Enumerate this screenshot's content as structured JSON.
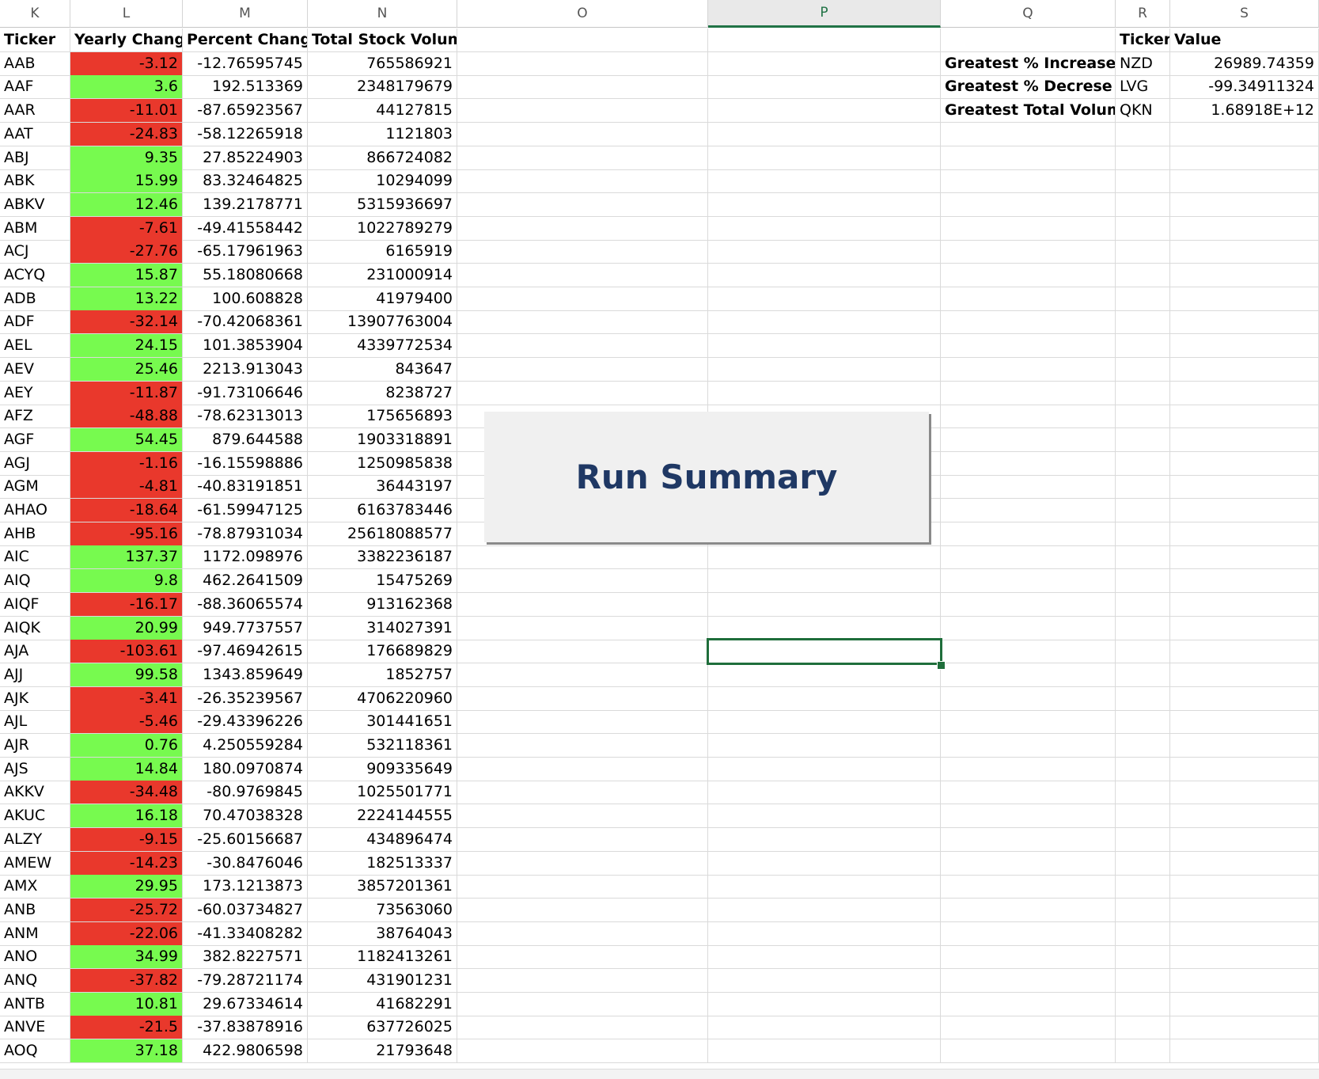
{
  "columns": [
    {
      "letter": "K",
      "selected": false
    },
    {
      "letter": "L",
      "selected": false
    },
    {
      "letter": "M",
      "selected": false
    },
    {
      "letter": "N",
      "selected": false
    },
    {
      "letter": "O",
      "selected": false
    },
    {
      "letter": "P",
      "selected": true
    },
    {
      "letter": "Q",
      "selected": false
    },
    {
      "letter": "R",
      "selected": false
    },
    {
      "letter": "S",
      "selected": false
    }
  ],
  "table_headers": {
    "ticker": "Ticker",
    "yearly_change": "Yearly Change",
    "percent_change": "Percent Change",
    "total_volume": "Total Stock Volume"
  },
  "rows": [
    {
      "ticker": "AAB",
      "yearly": "-3.12",
      "positive": false,
      "pct": "-12.76595745",
      "vol": "765586921"
    },
    {
      "ticker": "AAF",
      "yearly": "3.6",
      "positive": true,
      "pct": "192.513369",
      "vol": "2348179679"
    },
    {
      "ticker": "AAR",
      "yearly": "-11.01",
      "positive": false,
      "pct": "-87.65923567",
      "vol": "44127815"
    },
    {
      "ticker": "AAT",
      "yearly": "-24.83",
      "positive": false,
      "pct": "-58.12265918",
      "vol": "1121803"
    },
    {
      "ticker": "ABJ",
      "yearly": "9.35",
      "positive": true,
      "pct": "27.85224903",
      "vol": "866724082"
    },
    {
      "ticker": "ABK",
      "yearly": "15.99",
      "positive": true,
      "pct": "83.32464825",
      "vol": "10294099"
    },
    {
      "ticker": "ABKV",
      "yearly": "12.46",
      "positive": true,
      "pct": "139.2178771",
      "vol": "5315936697"
    },
    {
      "ticker": "ABM",
      "yearly": "-7.61",
      "positive": false,
      "pct": "-49.41558442",
      "vol": "1022789279"
    },
    {
      "ticker": "ACJ",
      "yearly": "-27.76",
      "positive": false,
      "pct": "-65.17961963",
      "vol": "6165919"
    },
    {
      "ticker": "ACYQ",
      "yearly": "15.87",
      "positive": true,
      "pct": "55.18080668",
      "vol": "231000914"
    },
    {
      "ticker": "ADB",
      "yearly": "13.22",
      "positive": true,
      "pct": "100.608828",
      "vol": "41979400"
    },
    {
      "ticker": "ADF",
      "yearly": "-32.14",
      "positive": false,
      "pct": "-70.42068361",
      "vol": "13907763004"
    },
    {
      "ticker": "AEL",
      "yearly": "24.15",
      "positive": true,
      "pct": "101.3853904",
      "vol": "4339772534"
    },
    {
      "ticker": "AEV",
      "yearly": "25.46",
      "positive": true,
      "pct": "2213.913043",
      "vol": "843647"
    },
    {
      "ticker": "AEY",
      "yearly": "-11.87",
      "positive": false,
      "pct": "-91.73106646",
      "vol": "8238727"
    },
    {
      "ticker": "AFZ",
      "yearly": "-48.88",
      "positive": false,
      "pct": "-78.62313013",
      "vol": "175656893"
    },
    {
      "ticker": "AGF",
      "yearly": "54.45",
      "positive": true,
      "pct": "879.644588",
      "vol": "1903318891"
    },
    {
      "ticker": "AGJ",
      "yearly": "-1.16",
      "positive": false,
      "pct": "-16.15598886",
      "vol": "1250985838"
    },
    {
      "ticker": "AGM",
      "yearly": "-4.81",
      "positive": false,
      "pct": "-40.83191851",
      "vol": "36443197"
    },
    {
      "ticker": "AHAO",
      "yearly": "-18.64",
      "positive": false,
      "pct": "-61.59947125",
      "vol": "6163783446"
    },
    {
      "ticker": "AHB",
      "yearly": "-95.16",
      "positive": false,
      "pct": "-78.87931034",
      "vol": "25618088577"
    },
    {
      "ticker": "AIC",
      "yearly": "137.37",
      "positive": true,
      "pct": "1172.098976",
      "vol": "3382236187"
    },
    {
      "ticker": "AIQ",
      "yearly": "9.8",
      "positive": true,
      "pct": "462.2641509",
      "vol": "15475269"
    },
    {
      "ticker": "AIQF",
      "yearly": "-16.17",
      "positive": false,
      "pct": "-88.36065574",
      "vol": "913162368"
    },
    {
      "ticker": "AIQK",
      "yearly": "20.99",
      "positive": true,
      "pct": "949.7737557",
      "vol": "314027391"
    },
    {
      "ticker": "AJA",
      "yearly": "-103.61",
      "positive": false,
      "pct": "-97.46942615",
      "vol": "176689829"
    },
    {
      "ticker": "AJJ",
      "yearly": "99.58",
      "positive": true,
      "pct": "1343.859649",
      "vol": "1852757"
    },
    {
      "ticker": "AJK",
      "yearly": "-3.41",
      "positive": false,
      "pct": "-26.35239567",
      "vol": "4706220960"
    },
    {
      "ticker": "AJL",
      "yearly": "-5.46",
      "positive": false,
      "pct": "-29.43396226",
      "vol": "301441651"
    },
    {
      "ticker": "AJR",
      "yearly": "0.76",
      "positive": true,
      "pct": "4.250559284",
      "vol": "532118361"
    },
    {
      "ticker": "AJS",
      "yearly": "14.84",
      "positive": true,
      "pct": "180.0970874",
      "vol": "909335649"
    },
    {
      "ticker": "AKKV",
      "yearly": "-34.48",
      "positive": false,
      "pct": "-80.9769845",
      "vol": "1025501771"
    },
    {
      "ticker": "AKUC",
      "yearly": "16.18",
      "positive": true,
      "pct": "70.47038328",
      "vol": "2224144555"
    },
    {
      "ticker": "ALZY",
      "yearly": "-9.15",
      "positive": false,
      "pct": "-25.60156687",
      "vol": "434896474"
    },
    {
      "ticker": "AMEW",
      "yearly": "-14.23",
      "positive": false,
      "pct": "-30.8476046",
      "vol": "182513337"
    },
    {
      "ticker": "AMX",
      "yearly": "29.95",
      "positive": true,
      "pct": "173.1213873",
      "vol": "3857201361"
    },
    {
      "ticker": "ANB",
      "yearly": "-25.72",
      "positive": false,
      "pct": "-60.03734827",
      "vol": "73563060"
    },
    {
      "ticker": "ANM",
      "yearly": "-22.06",
      "positive": false,
      "pct": "-41.33408282",
      "vol": "38764043"
    },
    {
      "ticker": "ANO",
      "yearly": "34.99",
      "positive": true,
      "pct": "382.8227571",
      "vol": "1182413261"
    },
    {
      "ticker": "ANQ",
      "yearly": "-37.82",
      "positive": false,
      "pct": "-79.28721174",
      "vol": "431901231"
    },
    {
      "ticker": "ANTB",
      "yearly": "10.81",
      "positive": true,
      "pct": "29.67334614",
      "vol": "41682291"
    },
    {
      "ticker": "ANVE",
      "yearly": "-21.5",
      "positive": false,
      "pct": "-37.83878916",
      "vol": "637726025"
    },
    {
      "ticker": "AOQ",
      "yearly": "37.18",
      "positive": true,
      "pct": "422.9806598",
      "vol": "21793648"
    }
  ],
  "summary": {
    "ticker_header": "Ticker",
    "value_header": "Value",
    "rows": [
      {
        "label": "Greatest % Increase",
        "ticker": "NZD",
        "value": "26989.74359"
      },
      {
        "label": "Greatest % Decrese",
        "ticker": "LVG",
        "value": "-99.34911324"
      },
      {
        "label": "Greatest Total Volume",
        "ticker": "QKN",
        "value": "1.68918E+12"
      }
    ]
  },
  "button": {
    "label": "Run Summary"
  },
  "colors": {
    "positive_fill": "#77fa4f",
    "negative_fill": "#e9382c",
    "selection": "#1f6e3b",
    "button_text": "#1f3864",
    "button_face": "#f0f0f0"
  }
}
